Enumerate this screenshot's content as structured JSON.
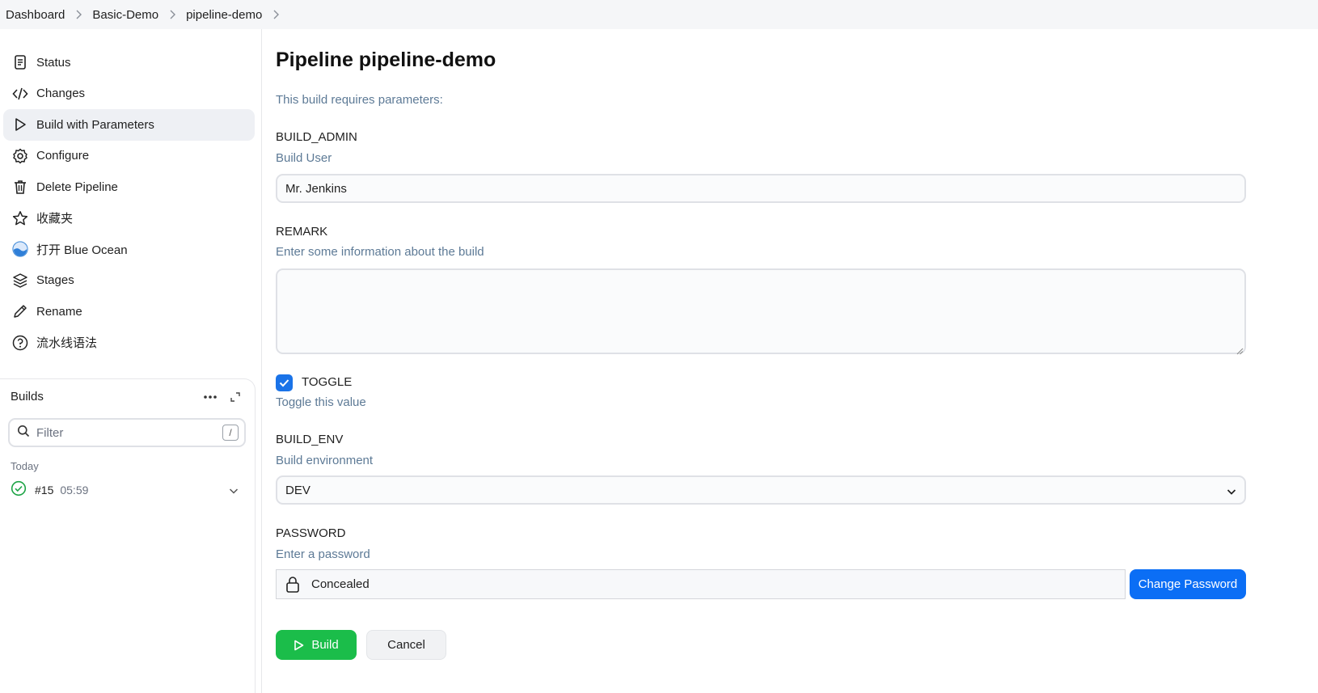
{
  "breadcrumb": {
    "items": [
      {
        "label": "Dashboard"
      },
      {
        "label": "Basic-Demo"
      },
      {
        "label": "pipeline-demo"
      }
    ]
  },
  "sidebar": {
    "items": [
      {
        "label": "Status",
        "icon": "status-document-icon"
      },
      {
        "label": "Changes",
        "icon": "code-icon"
      },
      {
        "label": "Build with Parameters",
        "icon": "play-icon",
        "active": true
      },
      {
        "label": "Configure",
        "icon": "gear-icon"
      },
      {
        "label": "Delete Pipeline",
        "icon": "trash-icon"
      },
      {
        "label": "收藏夹",
        "icon": "star-icon"
      },
      {
        "label": "打开 Blue Ocean",
        "icon": "blue-ocean-icon"
      },
      {
        "label": "Stages",
        "icon": "layers-icon"
      },
      {
        "label": "Rename",
        "icon": "pencil-icon"
      },
      {
        "label": "流水线语法",
        "icon": "help-icon"
      }
    ]
  },
  "builds": {
    "title": "Builds",
    "filter_placeholder": "Filter",
    "shortcut_key": "/",
    "group_label": "Today",
    "rows": [
      {
        "number": "#15",
        "time": "05:59",
        "status": "success"
      }
    ]
  },
  "main": {
    "title": "Pipeline pipeline-demo",
    "requires_text": "This build requires parameters:",
    "params": {
      "build_admin": {
        "name": "BUILD_ADMIN",
        "description": "Build User",
        "value": "Mr. Jenkins"
      },
      "remark": {
        "name": "REMARK",
        "description": "Enter some information about the build",
        "value": ""
      },
      "toggle": {
        "name": "TOGGLE",
        "description": "Toggle this value",
        "checked": true
      },
      "build_env": {
        "name": "BUILD_ENV",
        "description": "Build environment",
        "selected": "DEV"
      },
      "password": {
        "name": "PASSWORD",
        "description": "Enter a password",
        "value": "Concealed",
        "change_label": "Change Password"
      }
    },
    "actions": {
      "build_label": "Build",
      "cancel_label": "Cancel"
    }
  },
  "colors": {
    "accent_blue": "#0b6ef5",
    "build_green": "#1bbd4a",
    "success_green": "#1ea446",
    "description_text": "#5d7a96"
  }
}
